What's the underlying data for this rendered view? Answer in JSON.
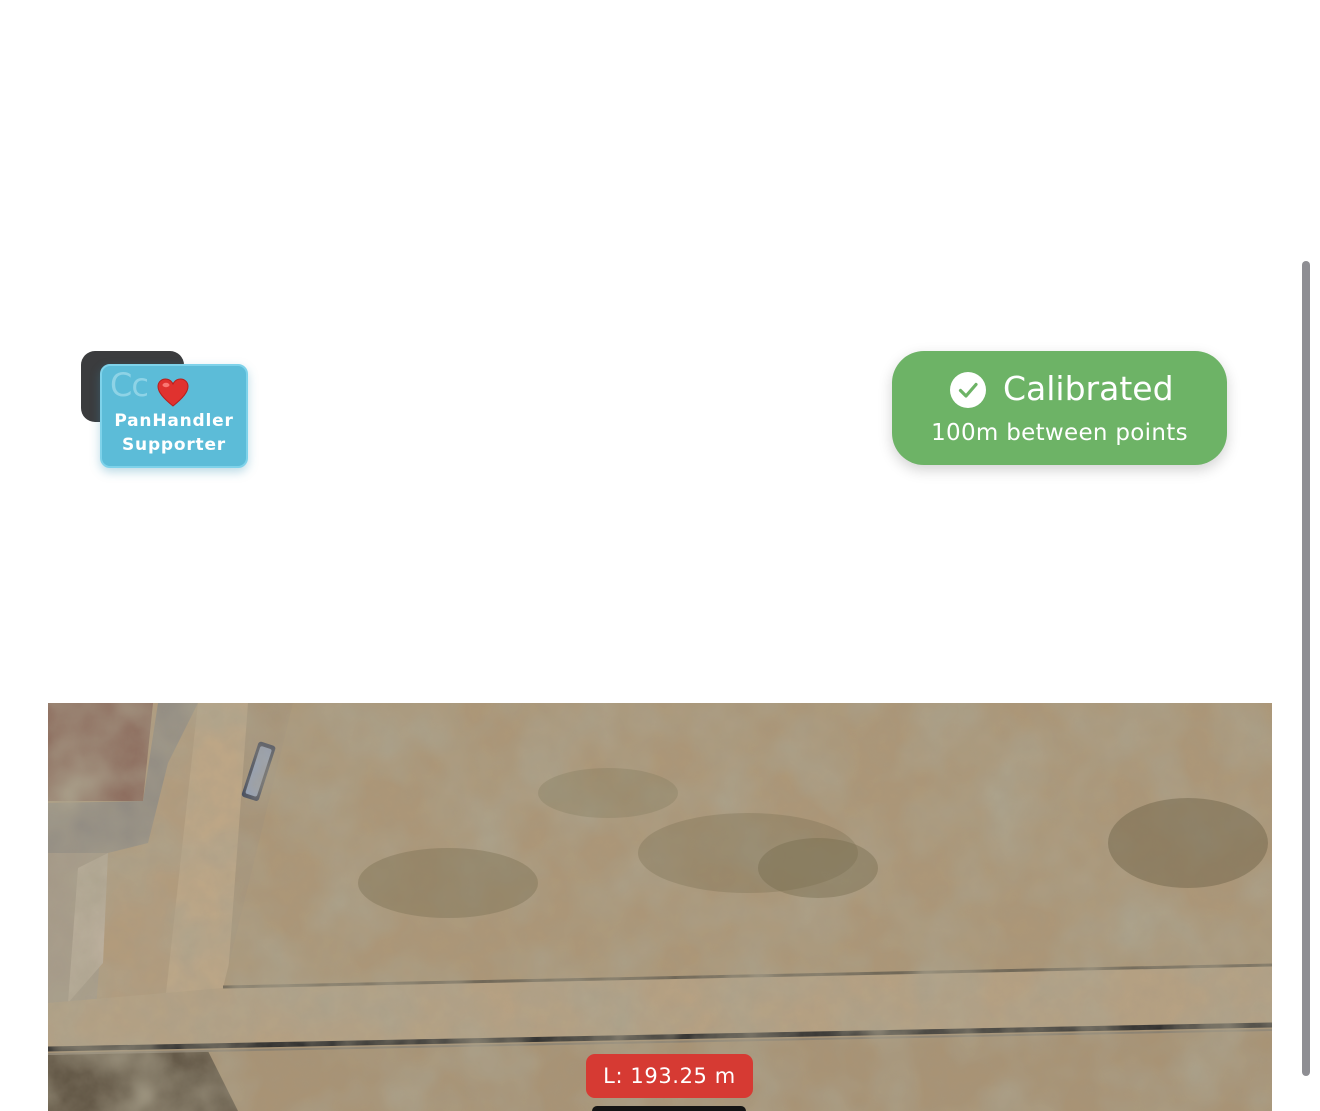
{
  "badge": {
    "overlay_text": "Cc",
    "heart_icon": "heart-icon",
    "line1": "PanHandler",
    "line2": "Supporter",
    "colors": {
      "front": "#5cbcd8",
      "back": "#3b3c3e",
      "heart": "#e0322f"
    }
  },
  "calibration": {
    "title": "Calibrated",
    "subtitle": "100m between points",
    "icon": "check-circle-icon",
    "color": "#6db366"
  },
  "map": {
    "type": "satellite-view"
  },
  "measurement": {
    "label": "L: 193.25 m",
    "color": "#d63a33"
  },
  "scrollbar": {
    "color": "#8e8e93"
  }
}
